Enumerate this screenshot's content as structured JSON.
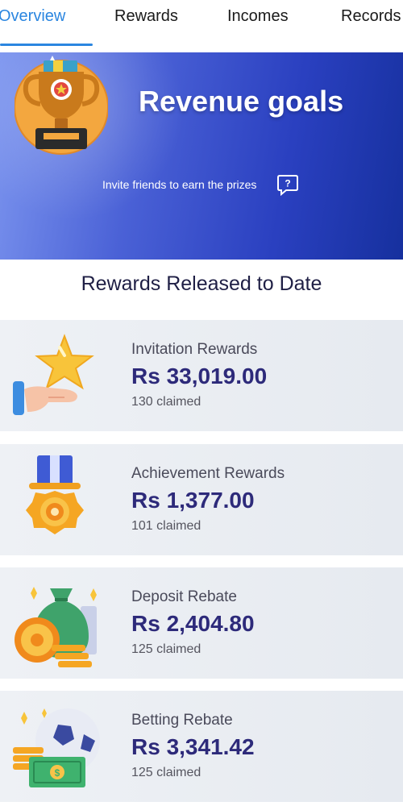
{
  "tabs": [
    {
      "label": "Overview",
      "active": true
    },
    {
      "label": "Rewards",
      "active": false
    },
    {
      "label": "Incomes",
      "active": false
    },
    {
      "label": "Records",
      "active": false
    }
  ],
  "banner": {
    "title": "Revenue goals",
    "subtitle": "Invite friends to earn the prizes",
    "help_icon": "question-bubble-icon",
    "trophy_icon": "trophy-icon"
  },
  "section_title": "Rewards Released to Date",
  "rewards": [
    {
      "label": "Invitation Rewards",
      "amount": "Rs 33,019.00",
      "claimed": "130 claimed",
      "icon": "star-hand-icon"
    },
    {
      "label": "Achievement Rewards",
      "amount": "Rs 1,377.00",
      "claimed": "101 claimed",
      "icon": "medal-icon"
    },
    {
      "label": "Deposit Rebate",
      "amount": "Rs 2,404.80",
      "claimed": "125 claimed",
      "icon": "money-bag-icon"
    },
    {
      "label": "Betting Rebate",
      "amount": "Rs 3,341.42",
      "claimed": "125 claimed",
      "icon": "soccer-cash-icon"
    }
  ],
  "colors": {
    "accent": "#2b86e0",
    "amount": "#2d2a7a",
    "banner_start": "#7c95ef",
    "banner_end": "#16309e"
  }
}
